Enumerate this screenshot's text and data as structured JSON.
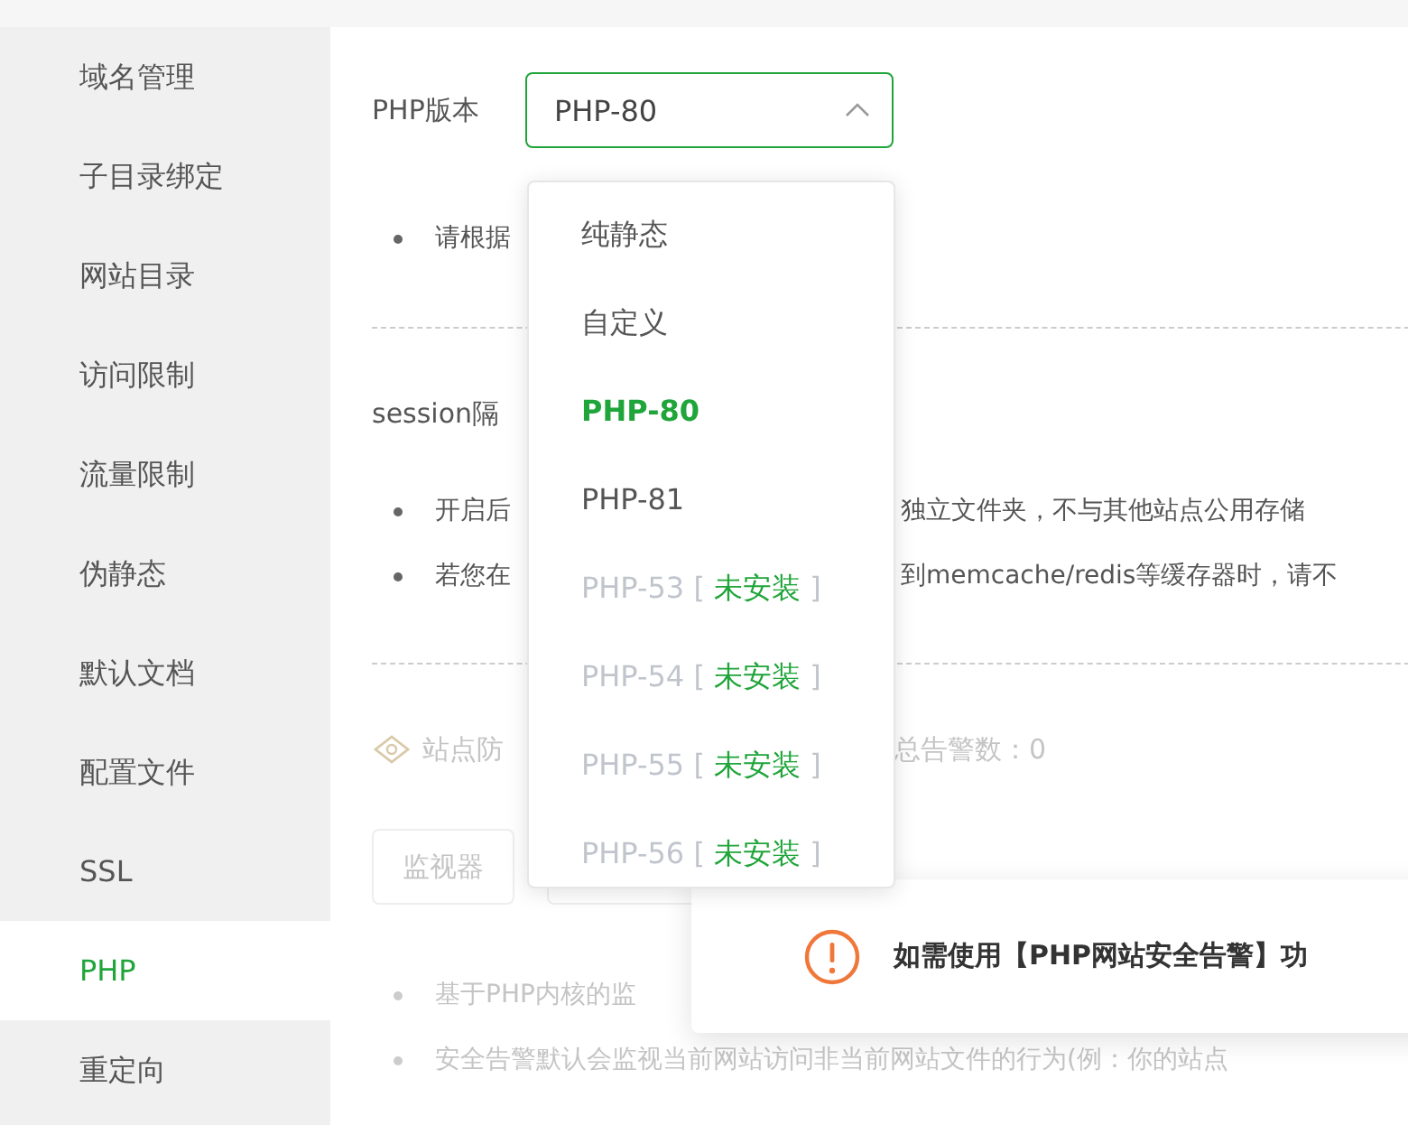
{
  "sidebar": {
    "items": [
      {
        "label": "域名管理",
        "selected": false
      },
      {
        "label": "子目录绑定",
        "selected": false
      },
      {
        "label": "网站目录",
        "selected": false
      },
      {
        "label": "访问限制",
        "selected": false
      },
      {
        "label": "流量限制",
        "selected": false
      },
      {
        "label": "伪静态",
        "selected": false
      },
      {
        "label": "默认文档",
        "selected": false
      },
      {
        "label": "配置文件",
        "selected": false
      },
      {
        "label": "SSL",
        "selected": false
      },
      {
        "label": "PHP",
        "selected": true
      },
      {
        "label": "重定向",
        "selected": false
      }
    ]
  },
  "php_version": {
    "label": "PHP版本",
    "value": "PHP-80",
    "expanded": true,
    "options": [
      {
        "label": "纯静态",
        "selected": false,
        "disabled": false
      },
      {
        "label": "自定义",
        "selected": false,
        "disabled": false
      },
      {
        "label": "PHP-80",
        "selected": true,
        "disabled": false
      },
      {
        "label": "PHP-81",
        "selected": false,
        "disabled": false
      },
      {
        "label": "PHP-53",
        "selected": false,
        "disabled": true,
        "note_open": "[",
        "note": "未安装",
        "note_close": "]"
      },
      {
        "label": "PHP-54",
        "selected": false,
        "disabled": true,
        "note_open": "[",
        "note": "未安装",
        "note_close": "]"
      },
      {
        "label": "PHP-55",
        "selected": false,
        "disabled": true,
        "note_open": "[",
        "note": "未安装",
        "note_close": "]"
      },
      {
        "label": "PHP-56",
        "selected": false,
        "disabled": true,
        "note_open": "[",
        "note": "未安装",
        "note_close": "]"
      }
    ]
  },
  "version_tips": [
    {
      "left": "请根据"
    }
  ],
  "session": {
    "title": "session隔",
    "tips": [
      {
        "left": "开启后",
        "right": "独立文件夹，不与其他站点公用存储"
      },
      {
        "left": "若您在",
        "right": "到memcache/redis等缓存器时，请不"
      }
    ]
  },
  "alarm": {
    "title": "站点防",
    "count": "总告警数：0",
    "disabled": true,
    "buttons": [
      "监视器"
    ],
    "tips": [
      {
        "left": "基于PHP内核的监"
      },
      {
        "left": "安全告警默认会监视当前网站访问非当前网站文件的行为(例：你的站点"
      }
    ]
  },
  "toast": {
    "kind": "warning",
    "message": "如需使用【PHP网站安全告警】功"
  }
}
